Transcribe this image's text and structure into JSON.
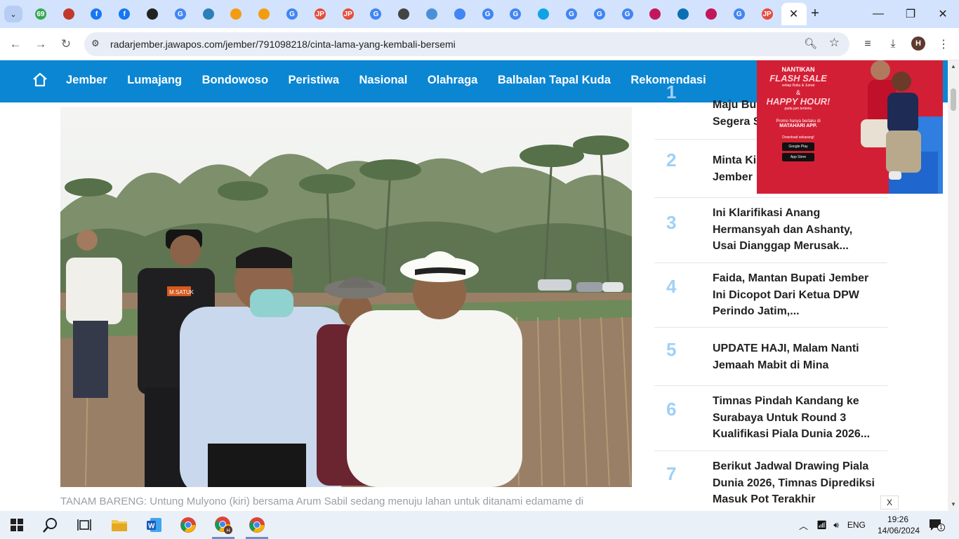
{
  "browser": {
    "url": "radarjember.jawapos.com/jember/791098218/cinta-lama-yang-kembali-bersemi",
    "profile_initial": "H",
    "tabs": [
      {
        "icon": "notification-icon",
        "color": "#34a853",
        "label": "69"
      },
      {
        "icon": "site-icon",
        "color": "#c0392b",
        "label": ""
      },
      {
        "icon": "facebook-icon",
        "color": "#1877f2",
        "label": "f"
      },
      {
        "icon": "facebook-icon",
        "color": "#1877f2",
        "label": "f"
      },
      {
        "icon": "site-icon",
        "color": "#222222",
        "label": ""
      },
      {
        "icon": "google-icon",
        "color": "#4285f4",
        "label": "G"
      },
      {
        "icon": "site-icon",
        "color": "#2c7fb8",
        "label": ""
      },
      {
        "icon": "site-icon",
        "color": "#f39c12",
        "label": ""
      },
      {
        "icon": "site-icon",
        "color": "#f39c12",
        "label": ""
      },
      {
        "icon": "google-icon",
        "color": "#4285f4",
        "label": "G"
      },
      {
        "icon": "jawapos-icon",
        "color": "#e74c3c",
        "label": "JP"
      },
      {
        "icon": "jawapos-icon",
        "color": "#e74c3c",
        "label": "JP"
      },
      {
        "icon": "google-icon",
        "color": "#4285f4",
        "label": "G"
      },
      {
        "icon": "audio-icon",
        "color": "#444444",
        "label": ""
      },
      {
        "icon": "site-icon",
        "color": "#4a90d9",
        "label": ""
      },
      {
        "icon": "docs-icon",
        "color": "#4285f4",
        "label": ""
      },
      {
        "icon": "google-icon",
        "color": "#4285f4",
        "label": "G"
      },
      {
        "icon": "google-icon",
        "color": "#4285f4",
        "label": "G"
      },
      {
        "icon": "site-icon",
        "color": "#0fa3e6",
        "label": ""
      },
      {
        "icon": "google-icon",
        "color": "#4285f4",
        "label": "G"
      },
      {
        "icon": "google-icon",
        "color": "#4285f4",
        "label": "G"
      },
      {
        "icon": "google-icon",
        "color": "#4285f4",
        "label": "G"
      },
      {
        "icon": "site-icon",
        "color": "#c2185b",
        "label": ""
      },
      {
        "icon": "site-icon",
        "color": "#0b6fb6",
        "label": ""
      },
      {
        "icon": "site-icon",
        "color": "#c2185b",
        "label": ""
      },
      {
        "icon": "google-icon",
        "color": "#4285f4",
        "label": "G"
      },
      {
        "icon": "jawapos-icon",
        "color": "#e74c3c",
        "label": "JP"
      }
    ]
  },
  "site": {
    "nav": [
      "Jember",
      "Lumajang",
      "Bondowoso",
      "Peristiwa",
      "Nasional",
      "Olahraga",
      "Balbalan Tapal Kuda",
      "Rekomendasi"
    ],
    "caption": "TANAM BARENG: Untung Mulyono (kiri) bersama Arum Sabil sedang menuju lahan untuk ditanami edamame di",
    "photo_patch_labels": {
      "left": "M.SATUK",
      "right": ""
    }
  },
  "popular": [
    {
      "num": "1",
      "title": "Maju Bupati ... Segera S..."
    },
    {
      "num": "2",
      "title": "Minta Ki... Jember..."
    },
    {
      "num": "3",
      "title": "Ini Klarifikasi Anang Hermansyah dan Ashanty, Usai Dianggap Merusak..."
    },
    {
      "num": "4",
      "title": "Faida, Mantan Bupati Jember Ini Dicopot Dari Ketua DPW Perindo Jatim,..."
    },
    {
      "num": "5",
      "title": "UPDATE HAJI, Malam Nanti Jemaah Mabit di Mina"
    },
    {
      "num": "6",
      "title": "Timnas Pindah Kandang ke Surabaya Untuk Round 3 Kualifikasi Piala Dunia 2026..."
    },
    {
      "num": "7",
      "title": "Berikut Jadwal Drawing Piala Dunia 2026, Timnas Diprediksi Masuk Pot Terakhir"
    }
  ],
  "popular_visible": {
    "item1_line1": "Maju Bu",
    "item1_line2": "Segera S",
    "item2_line1": "Minta Ki",
    "item2_line2": "Jember"
  },
  "ad": {
    "line1": "NANTIKAN",
    "line2": "FLASH SALE",
    "line3": "setiap Rabu & Jumat",
    "line4": "&",
    "line5": "HAPPY HOUR!",
    "line6": "pada jam tertentu",
    "line7": "Promo hanya berlaku di",
    "line8": "MATAHARI APP.",
    "line9": "Download sekarang!",
    "store1": "Google Play",
    "store2": "App Store",
    "close_label": "X"
  },
  "taskbar": {
    "time": "19:26",
    "date": "14/06/2024",
    "lang": "ENG",
    "notifications": "1"
  }
}
